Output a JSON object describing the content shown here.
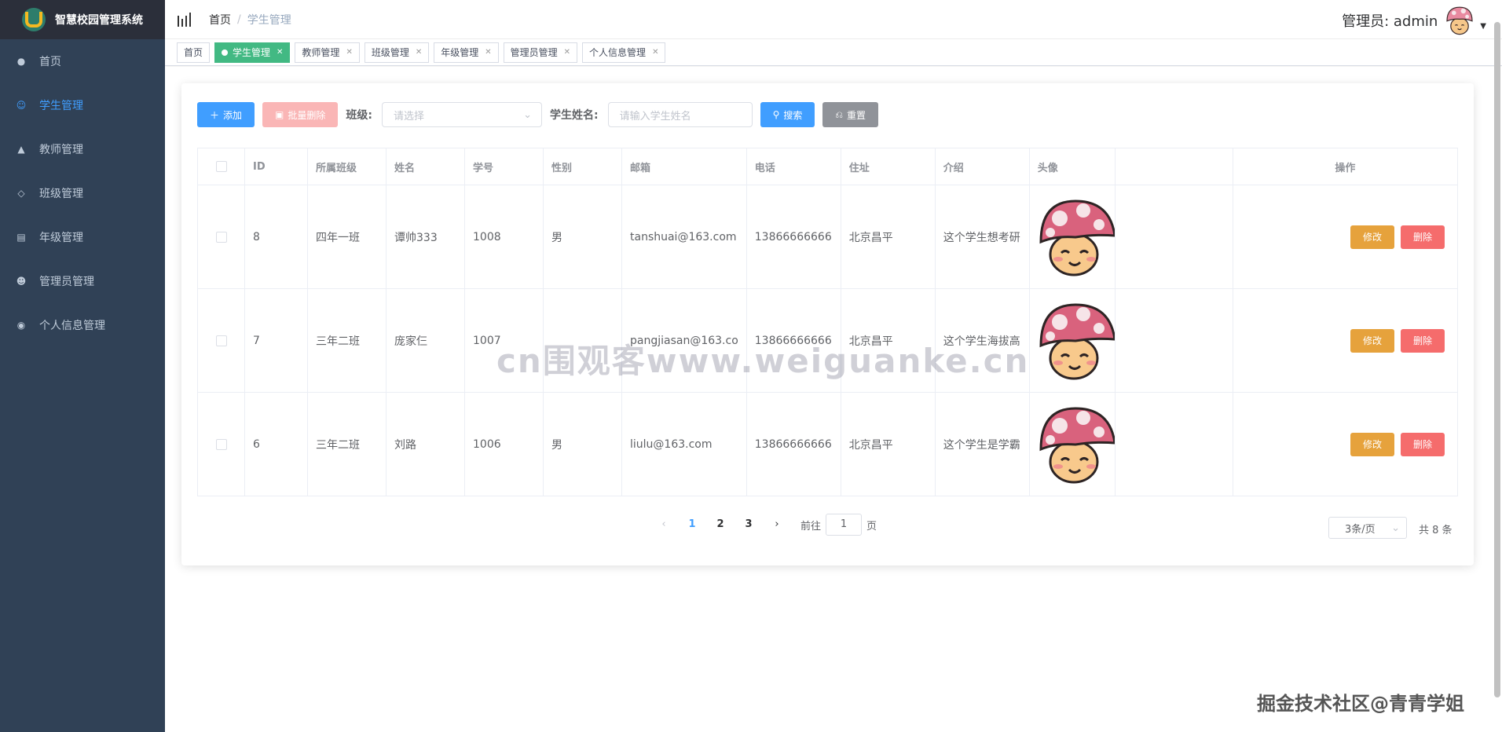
{
  "app": {
    "title": "智慧校园管理系统"
  },
  "sidebar": {
    "items": [
      {
        "label": "首页",
        "icon": "dashboard-icon",
        "active": false
      },
      {
        "label": "学生管理",
        "icon": "user-icon",
        "active": true
      },
      {
        "label": "教师管理",
        "icon": "people-icon",
        "active": false
      },
      {
        "label": "班级管理",
        "icon": "tag-icon",
        "active": false
      },
      {
        "label": "年级管理",
        "icon": "calendar-icon",
        "active": false
      },
      {
        "label": "管理员管理",
        "icon": "admin-icon",
        "active": false
      },
      {
        "label": "个人信息管理",
        "icon": "profile-icon",
        "active": false
      }
    ]
  },
  "navbar": {
    "breadcrumb_home": "首页",
    "breadcrumb_sep": "/",
    "breadcrumb_current": "学生管理",
    "user_label": "管理员: admin"
  },
  "tags": [
    {
      "label": "首页",
      "active": false,
      "closable": false
    },
    {
      "label": "学生管理",
      "active": true,
      "closable": true
    },
    {
      "label": "教师管理",
      "active": false,
      "closable": true
    },
    {
      "label": "班级管理",
      "active": false,
      "closable": true
    },
    {
      "label": "年级管理",
      "active": false,
      "closable": true
    },
    {
      "label": "管理员管理",
      "active": false,
      "closable": true
    },
    {
      "label": "个人信息管理",
      "active": false,
      "closable": true
    }
  ],
  "toolbar": {
    "add_label": "添加",
    "batch_delete_label": "批量删除",
    "class_label": "班级:",
    "class_placeholder": "请选择",
    "name_label": "学生姓名:",
    "name_placeholder": "请输入学生姓名",
    "search_label": "搜索",
    "reset_label": "重置"
  },
  "table": {
    "headers": [
      "ID",
      "所属班级",
      "姓名",
      "学号",
      "性别",
      "邮箱",
      "电话",
      "住址",
      "介绍",
      "头像",
      "操作"
    ],
    "rows": [
      {
        "id": "8",
        "class": "四年一班",
        "name": "谭帅333",
        "number": "1008",
        "gender": "男",
        "email": "tanshuai@163.com",
        "phone": "13866666666",
        "address": "北京昌平",
        "intro": "这个学生想考研"
      },
      {
        "id": "7",
        "class": "三年二班",
        "name": "庞家仨",
        "number": "1007",
        "gender": "",
        "email": "pangjiasan@163.co",
        "phone": "13866666666",
        "address": "北京昌平",
        "intro": "这个学生海拔高"
      },
      {
        "id": "6",
        "class": "三年二班",
        "name": "刘路",
        "number": "1006",
        "gender": "男",
        "email": "liulu@163.com",
        "phone": "13866666666",
        "address": "北京昌平",
        "intro": "这个学生是学霸"
      }
    ],
    "edit_label": "修改",
    "delete_label": "删除"
  },
  "pagination": {
    "pages": [
      "1",
      "2",
      "3"
    ],
    "current": "1",
    "goto_prefix": "前往",
    "goto_value": "1",
    "goto_suffix": "页",
    "page_size": "3条/页",
    "total": "共 8 条"
  },
  "watermarks": {
    "center": "cn围观客www.weiguanke.cn",
    "corner": "掘金技术社区@青青学姐"
  },
  "colors": {
    "sidebar_bg": "#304156",
    "accent": "#409eff",
    "tag_active": "#42b983",
    "edit": "#e6a23c",
    "delete": "#f56c6c"
  }
}
